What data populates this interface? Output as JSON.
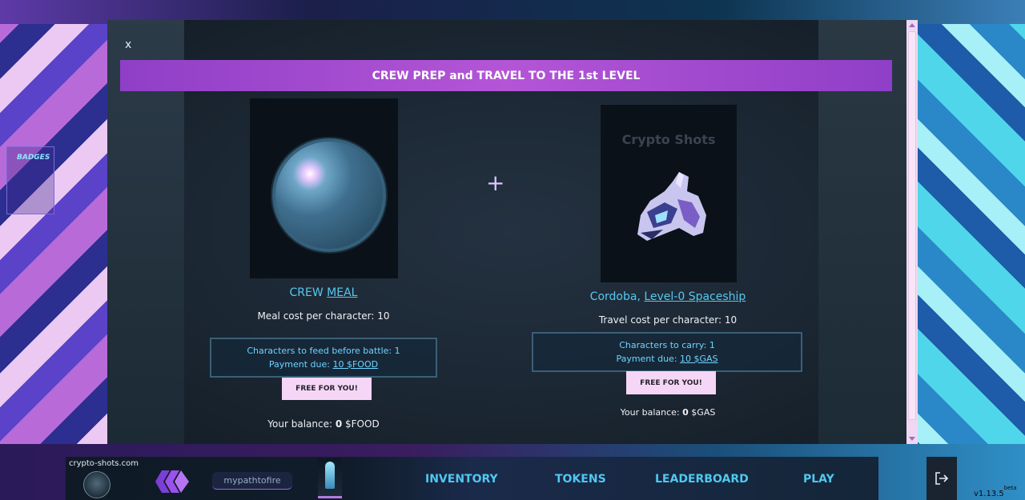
{
  "sidebar": {
    "badges_label": "BADGES"
  },
  "modal": {
    "close_label": "x",
    "title": "CREW PREP and TRAVEL TO THE 1st LEVEL",
    "plus_symbol": "+",
    "meal": {
      "title_prefix": "CREW ",
      "title_link": "MEAL",
      "cost_text": "Meal cost per character: 10",
      "info_line1": "Characters to feed before battle: 1",
      "payment_prefix": "Payment due: ",
      "payment_link": "10 $FOOD",
      "button_label": "FREE FOR YOU!",
      "balance_prefix": "Your balance: ",
      "balance_value": "0",
      "balance_unit": " $FOOD"
    },
    "ship": {
      "brand_text": "Crypto Shots",
      "title_prefix": "Cordoba, ",
      "title_link": "Level-0 Spaceship",
      "cost_text": "Travel cost per character: 10",
      "info_line1": "Characters to carry: 1",
      "payment_prefix": "Payment due: ",
      "payment_link": "10 $GAS",
      "button_label": "FREE FOR YOU!",
      "balance_prefix": "Your balance: ",
      "balance_value": "0",
      "balance_unit": " $GAS"
    }
  },
  "footer": {
    "site": "crypto-shots.com",
    "username": "mypathtofire",
    "nav": {
      "inventory": "INVENTORY",
      "tokens": "TOKENS",
      "leaderboard": "LEADERBOARD",
      "play": "PLAY"
    },
    "version": "v1.13.5",
    "version_tag": "beta"
  },
  "icons": [
    "close-icon",
    "plus-icon",
    "coin-icon",
    "hive-icon",
    "avatar",
    "logout-icon"
  ]
}
